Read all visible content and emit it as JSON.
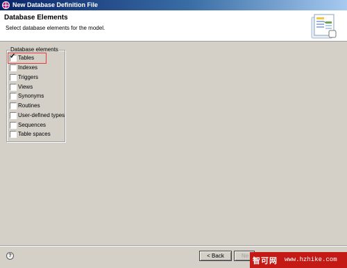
{
  "window": {
    "title": "New Database Definition File"
  },
  "header": {
    "title": "Database Elements",
    "description": "Select database elements for the model."
  },
  "group": {
    "legend": "Database elements",
    "items": [
      {
        "label": "Tables",
        "checked": true
      },
      {
        "label": "Indexes",
        "checked": false
      },
      {
        "label": "Triggers",
        "checked": false
      },
      {
        "label": "Views",
        "checked": false
      },
      {
        "label": "Synonyms",
        "checked": false
      },
      {
        "label": "Routines",
        "checked": false
      },
      {
        "label": "User-defined types",
        "checked": false
      },
      {
        "label": "Sequences",
        "checked": false
      },
      {
        "label": "Table spaces",
        "checked": false
      }
    ]
  },
  "footer": {
    "help_icon": "?",
    "back_label": "< Back",
    "next_label_partial": "Ne",
    "watermark_cn": "智可网",
    "watermark_url": "www.hzhike.com"
  },
  "colors": {
    "highlight": "#e53935",
    "watermark_bg": "#c41a15"
  }
}
